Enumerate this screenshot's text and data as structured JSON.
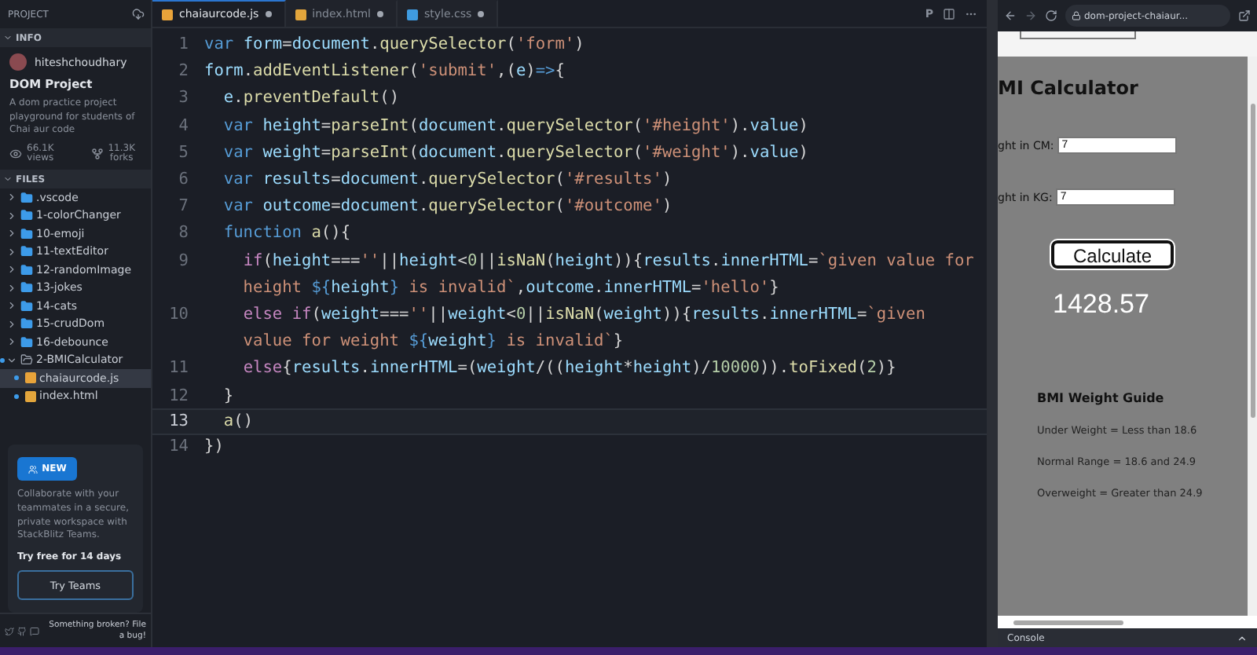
{
  "sidebar": {
    "title": "PROJECT",
    "info": {
      "heading": "INFO",
      "expanded": true,
      "user": "hiteshchoudhary",
      "project": "DOM Project",
      "description": "A dom practice project playground for students of Chai aur code",
      "views": {
        "count": "66.1K",
        "label": "views"
      },
      "forks": {
        "count": "11.3K",
        "label": "forks"
      }
    },
    "files": {
      "heading": "FILES",
      "expanded": true,
      "items": [
        {
          "name": ".vscode",
          "kind": "folder",
          "expanded": false
        },
        {
          "name": "1-colorChanger",
          "kind": "folder",
          "expanded": false
        },
        {
          "name": "10-emoji",
          "kind": "folder",
          "expanded": false
        },
        {
          "name": "11-textEditor",
          "kind": "folder",
          "expanded": false
        },
        {
          "name": "12-randomImage",
          "kind": "folder",
          "expanded": false
        },
        {
          "name": "13-jokes",
          "kind": "folder",
          "expanded": false
        },
        {
          "name": "14-cats",
          "kind": "folder",
          "expanded": false
        },
        {
          "name": "15-crudDom",
          "kind": "folder",
          "expanded": false
        },
        {
          "name": "16-debounce",
          "kind": "folder",
          "expanded": false
        },
        {
          "name": "2-BMICalculator",
          "kind": "folder",
          "expanded": true,
          "modified": true,
          "children": [
            {
              "name": "chaiaurcode.js",
              "kind": "js",
              "selected": true,
              "modified": true
            },
            {
              "name": "index.html",
              "kind": "html",
              "selected": false,
              "modified": true
            }
          ]
        }
      ]
    },
    "promo": {
      "badge": "NEW",
      "text": "Collaborate with your teammates in a secure, private workspace with StackBlitz Teams.",
      "offer": "Try free for 14 days",
      "button": "Try Teams"
    },
    "footer": {
      "text": "Something broken? File a bug!"
    }
  },
  "editor": {
    "tabs": [
      {
        "label": "chaiaurcode.js",
        "kind": "js",
        "selected": true,
        "modified": true
      },
      {
        "label": "index.html",
        "kind": "html",
        "selected": false,
        "modified": true
      },
      {
        "label": "style.css",
        "kind": "css",
        "selected": false,
        "modified": true
      }
    ],
    "preview_button": "P",
    "lines": [
      {
        "number": "1",
        "active": false,
        "rows": [
          "var form=document.querySelector('form')"
        ]
      },
      {
        "number": "2",
        "active": false,
        "rows": [
          "form.addEventListener('submit',(e)=>{"
        ]
      },
      {
        "number": "3",
        "active": false,
        "rows": [
          "  e.preventDefault()"
        ]
      },
      {
        "number": "4",
        "active": false,
        "rows": [
          "  var height=parseInt(document.querySelector('#height').value)"
        ]
      },
      {
        "number": "5",
        "active": false,
        "rows": [
          "  var weight=parseInt(document.querySelector('#weight').value)"
        ]
      },
      {
        "number": "6",
        "active": false,
        "rows": [
          "  var results=document.querySelector('#results')"
        ]
      },
      {
        "number": "7",
        "active": false,
        "rows": [
          "  var outcome=document.querySelector('#outcome')"
        ]
      },
      {
        "number": "8",
        "active": false,
        "rows": [
          "  function a(){"
        ]
      },
      {
        "number": "9",
        "active": false,
        "rows": [
          "    if(height===''||height<0||isNaN(height)){results.innerHTML=`given value for",
          "    height ${height} is invalid`,outcome.innerHTML='hello'}"
        ]
      },
      {
        "number": "10",
        "active": false,
        "rows": [
          "    else if(weight===''||weight<0||isNaN(weight)){results.innerHTML=`given",
          "    value for weight ${weight} is invalid`}"
        ]
      },
      {
        "number": "11",
        "active": false,
        "rows": [
          "    else{results.innerHTML=(weight/((height*height)/10000)).toFixed(2)}"
        ]
      },
      {
        "number": "12",
        "active": false,
        "rows": [
          "  }"
        ]
      },
      {
        "number": "13",
        "active": true,
        "rows": [
          "  a()"
        ]
      },
      {
        "number": "14",
        "active": false,
        "rows": [
          "})"
        ]
      }
    ]
  },
  "preview": {
    "url": "dom-project-chaiaur...",
    "page": {
      "title": "MI Calculator",
      "fields": [
        {
          "label": "ght in CM:",
          "value": "7"
        },
        {
          "label": "ght in KG:",
          "value": "7"
        }
      ],
      "button": "Calculate",
      "result": "1428.57",
      "guide_title": "BMI Weight Guide",
      "guide": [
        "Under Weight = Less than 18.6",
        "Normal Range = 18.6 and 24.9",
        "Overweight = Greater than 24.9"
      ]
    },
    "console": "Console"
  }
}
